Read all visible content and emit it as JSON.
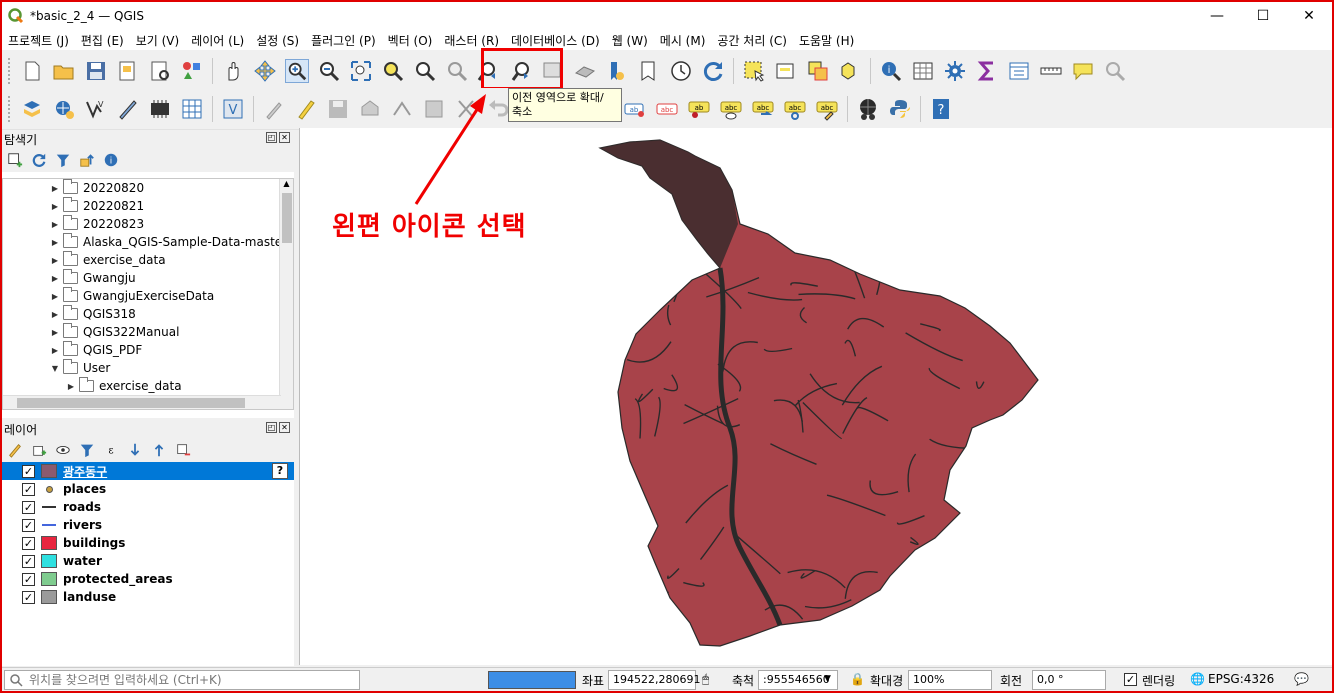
{
  "window": {
    "title": "*basic_2_4 — QGIS",
    "min": "—",
    "max": "☐",
    "close": "✕"
  },
  "menu": [
    "프로젝트 (J)",
    "편집 (E)",
    "보기 (V)",
    "레이어 (L)",
    "설정 (S)",
    "플러그인 (P)",
    "벡터 (O)",
    "래스터 (R)",
    "데이터베이스 (D)",
    "웹 (W)",
    "메시 (M)",
    "공간 처리 (C)",
    "도움말 (H)"
  ],
  "tooltip": {
    "line1": "이전 영역으로 확대/",
    "line2": "축소"
  },
  "annotation": "왼편 아이콘 선택",
  "browser": {
    "title": "탐색기",
    "items": [
      {
        "label": "20220820",
        "indent": 0,
        "open": false
      },
      {
        "label": "20220821",
        "indent": 0,
        "open": false
      },
      {
        "label": "20220823",
        "indent": 0,
        "open": false
      },
      {
        "label": "Alaska_QGIS-Sample-Data-master",
        "indent": 0,
        "open": false
      },
      {
        "label": "exercise_data",
        "indent": 0,
        "open": false
      },
      {
        "label": "Gwangju",
        "indent": 0,
        "open": false
      },
      {
        "label": "GwangjuExerciseData",
        "indent": 0,
        "open": false
      },
      {
        "label": "QGIS318",
        "indent": 0,
        "open": false
      },
      {
        "label": "QGIS322Manual",
        "indent": 0,
        "open": false
      },
      {
        "label": "QGIS_PDF",
        "indent": 0,
        "open": false
      },
      {
        "label": "User",
        "indent": 0,
        "open": true
      },
      {
        "label": "exercise_data",
        "indent": 1,
        "open": false
      }
    ]
  },
  "layers": {
    "title": "레이어",
    "items": [
      {
        "name": "광주동구",
        "type": "fill",
        "color": "#8b5a6e",
        "selected": true
      },
      {
        "name": "places",
        "type": "point",
        "color": "#c8a040",
        "selected": false
      },
      {
        "name": "roads",
        "type": "line",
        "color": "#333333",
        "selected": false
      },
      {
        "name": "rivers",
        "type": "line",
        "color": "#4466dd",
        "selected": false
      },
      {
        "name": "buildings",
        "type": "fill",
        "color": "#e8253f",
        "selected": false
      },
      {
        "name": "water",
        "type": "fill",
        "color": "#2ee0e0",
        "selected": false
      },
      {
        "name": "protected_areas",
        "type": "fill",
        "color": "#7fcc8f",
        "selected": false
      },
      {
        "name": "landuse",
        "type": "fill",
        "color": "#9a9a9a",
        "selected": false
      }
    ]
  },
  "status": {
    "search_placeholder": "위치를 찾으려면 입력하세요 (Ctrl+K)",
    "coord_label": "좌표",
    "coord_value": "194522,280691",
    "scale_label": "축척",
    "scale_value": ":955546560",
    "magnifier_label": "확대경",
    "magnifier_value": "100%",
    "rotation_label": "회전",
    "rotation_value": "0,0 °",
    "render_label": "렌더링",
    "crs": "EPSG:4326"
  },
  "colors": {
    "map_fill": "#a8434a",
    "map_stroke": "#2a2a2a",
    "selection": "#0078d7",
    "annotation": "#f00000"
  }
}
